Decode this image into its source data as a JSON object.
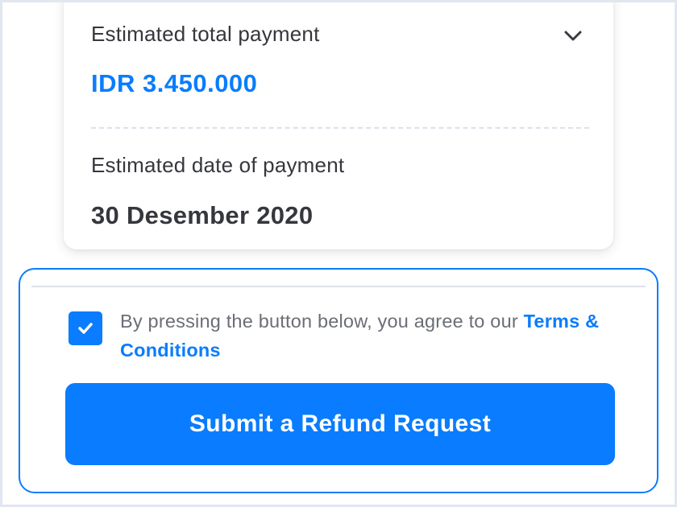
{
  "summary": {
    "total_label": "Estimated total payment",
    "total_amount": "IDR 3.450.000",
    "date_label": "Estimated date of payment",
    "date_value": "30 Desember 2020",
    "expand_icon": "chevron-down-icon"
  },
  "agreement": {
    "checked": true,
    "checkbox_icon": "checkmark-icon",
    "text_prefix": "By pressing the button below, you agree to our ",
    "terms_link": "Terms & Conditions"
  },
  "actions": {
    "submit_label": "Submit a Refund Request"
  },
  "colors": {
    "accent": "#0a7cff",
    "text_dark": "#35373d",
    "text_muted": "#6b6e76",
    "background": "#e1e6f0"
  }
}
